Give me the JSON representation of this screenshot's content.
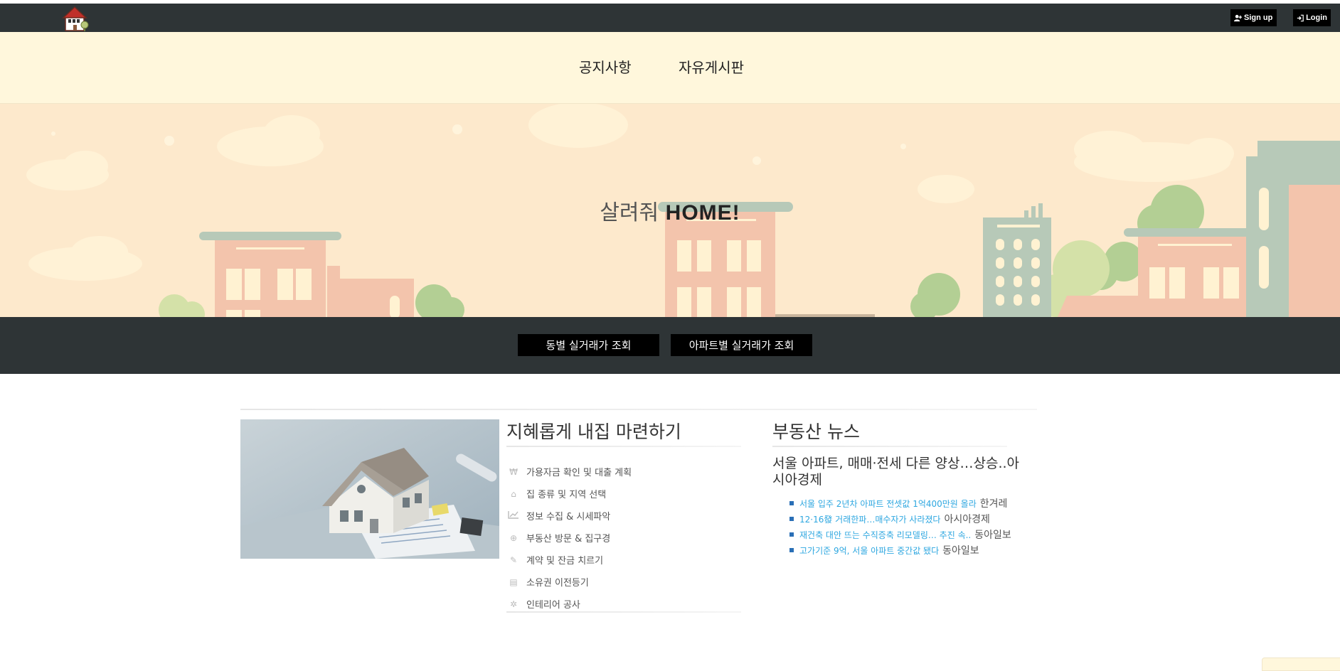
{
  "header": {
    "logo_icon": "house-logo-icon",
    "signup_label": "Sign up",
    "login_label": "Login"
  },
  "nav": {
    "items": [
      {
        "label": "공지사항"
      },
      {
        "label": "자유게시판"
      }
    ]
  },
  "hero": {
    "title_prefix": "살려줘",
    "title_emphasis": "HOME!"
  },
  "search": {
    "by_dong_label": "동별 실거래가 조회",
    "by_apt_label": "아파트별 실거래가 조회"
  },
  "guide": {
    "title": "지혜롭게 내집 마련하기",
    "steps": [
      {
        "icon": "won-icon",
        "glyph": "₩",
        "label": "가용자금 확인 및 대출 계획"
      },
      {
        "icon": "home-icon",
        "glyph": "⌂",
        "label": "집 종류 및 지역 선택"
      },
      {
        "icon": "chart-line-icon",
        "glyph": "📈",
        "label": "정보 수집 & 시세파악"
      },
      {
        "icon": "search-plus-icon",
        "glyph": "⊕",
        "label": "부동산 방문 & 집구경"
      },
      {
        "icon": "pencil-icon",
        "glyph": "✎",
        "label": "계약 및 잔금 치르기"
      },
      {
        "icon": "file-icon",
        "glyph": "▤",
        "label": "소유권 이전등기"
      },
      {
        "icon": "gear-icon",
        "glyph": "✲",
        "label": "인테리어 공사"
      }
    ]
  },
  "news": {
    "title": "부동산 뉴스",
    "headline": "서울 아파트, 매매·전세 다른 양상…상승..아시아경제",
    "items": [
      {
        "text": "서울 입주 2년차 아파트 전셋값 1억400만원 올라",
        "source": "한겨레"
      },
      {
        "text": "12·16發 거래한파…매수자가 사라졌다",
        "source": "아시아경제"
      },
      {
        "text": "재건축 대안 뜨는 수직증축 리모델링… 추진 속..",
        "source": "동아일보"
      },
      {
        "text": "고가기준 9억, 서울 아파트 중간값 됐다",
        "source": "동아일보"
      }
    ]
  },
  "colors": {
    "topbar": "#2e3436",
    "nav_bg": "#fff7dc",
    "hero_bg": "#fde9cc",
    "link": "#2ea7e0"
  }
}
